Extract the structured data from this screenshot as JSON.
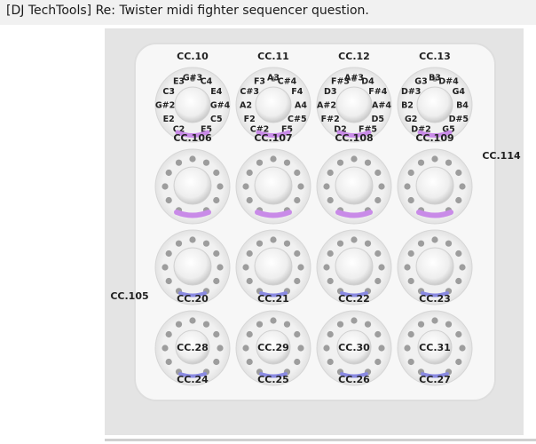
{
  "window": {
    "title": "[DJ TechTools] Re: Twister midi fighter sequencer question."
  },
  "controller": {
    "top_cc": [
      "CC.10",
      "CC.11",
      "CC.12",
      "CC.13"
    ],
    "side_left": "CC.105",
    "side_right": "CC.114",
    "rows": [
      {
        "style": "notes",
        "notes": [
          [
            "G#3",
            "C4",
            "E4",
            "G#4",
            "C5",
            "E5",
            "C2",
            "E2",
            "G#2",
            "C3",
            "E3"
          ],
          [
            "A3",
            "C#4",
            "F4",
            "A4",
            "C#5",
            "F5",
            "C#2",
            "F2",
            "A2",
            "C#3",
            "F3"
          ],
          [
            "A#3",
            "D4",
            "F#4",
            "A#4",
            "D5",
            "F#5",
            "D2",
            "F#2",
            "A#2",
            "D3",
            "F#3"
          ],
          [
            "B3",
            "D#4",
            "G4",
            "B4",
            "D#5",
            "G5",
            "D#2",
            "G2",
            "B2",
            "D#3",
            "G3"
          ]
        ],
        "bottom": [
          "CC.106",
          "CC.107",
          "CC.108",
          "CC.109"
        ]
      },
      {
        "style": "leds",
        "center": [
          "",
          "",
          "",
          ""
        ],
        "bottom": [
          "",
          "",
          "",
          ""
        ]
      },
      {
        "style": "leds-small",
        "center": [
          "",
          "",
          "",
          ""
        ],
        "bottom": [
          "CC.20",
          "CC.21",
          "CC.22",
          "CC.23"
        ]
      },
      {
        "style": "leds-label",
        "center": [
          "CC.28",
          "CC.29",
          "CC.30",
          "CC.31"
        ],
        "bottom": [
          "CC.24",
          "CC.25",
          "CC.26",
          "CC.27"
        ]
      }
    ]
  },
  "colors": {
    "pink_arc": "#c98be8",
    "blue_arc": "#8a8ae2",
    "led": "#9d9d9d"
  }
}
